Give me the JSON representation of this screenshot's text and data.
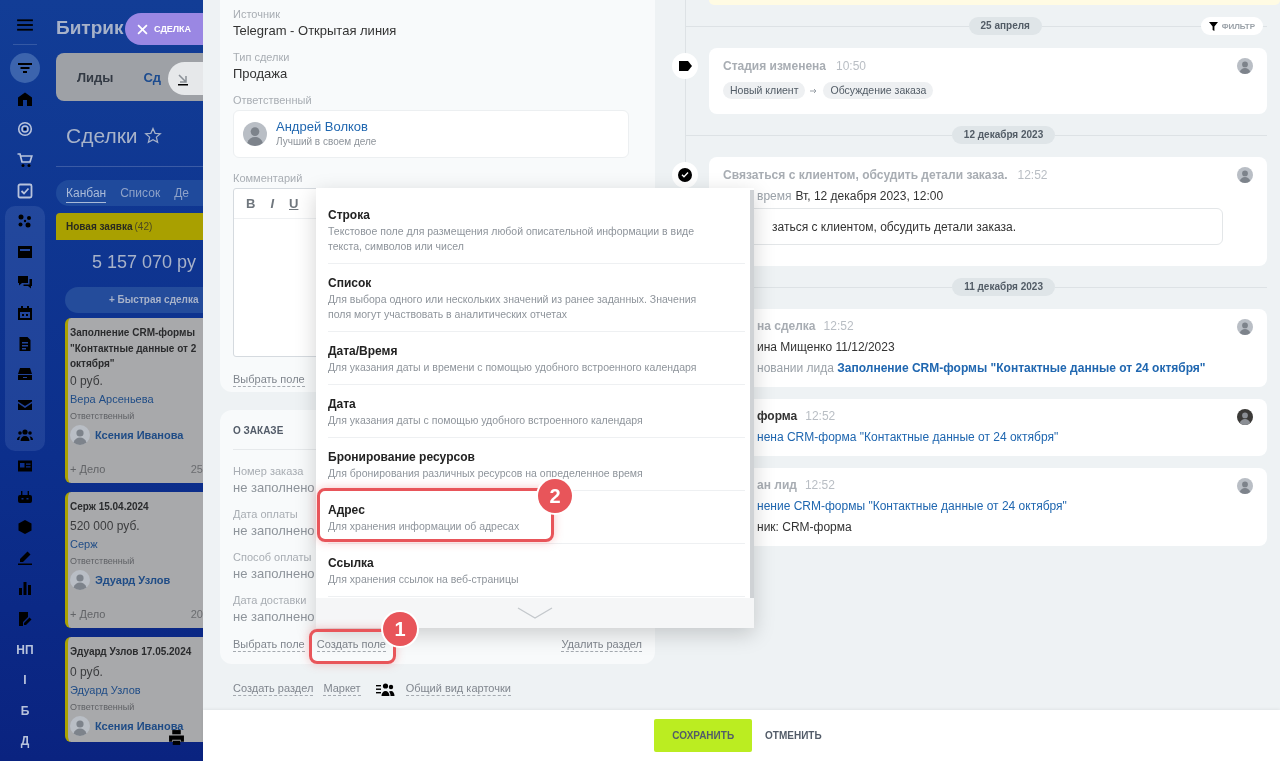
{
  "window": {
    "tab": "СДЕЛКА"
  },
  "sidebar": {
    "labels": [
      "НП",
      "I",
      "Б",
      "Д"
    ]
  },
  "crm": {
    "logo": "Битрик",
    "tabs": [
      {
        "label": "Лиды",
        "selected": false
      },
      {
        "label": "Сд",
        "selected": true
      }
    ],
    "heading": "Сделки",
    "views": [
      {
        "label": "Канбан",
        "selected": true
      },
      {
        "label": "Список",
        "selected": false
      },
      {
        "label": "Де",
        "selected": false
      }
    ],
    "column": {
      "title": "Новая заявка",
      "count": "(42)",
      "total": "5 157 070 ру",
      "quick_add": "+ Быстрая сделка"
    },
    "deals": [
      {
        "title_lines": [
          "Заполнение CRM-формы",
          "\"Контактные данные от 2",
          "октября\""
        ],
        "amount": "0 руб.",
        "client": "Вера Арсеньева",
        "role": "Ответственный",
        "responsible": "Ксения Иванова",
        "add": "+ Дело",
        "date": "25"
      },
      {
        "title_lines": [
          "Серж 15.04.2024"
        ],
        "amount": "520 000 руб.",
        "client": "Серж",
        "role": "Ответственный",
        "responsible": "Эдуард Узлов",
        "add": "+ Дело",
        "date": "20"
      },
      {
        "title_lines": [
          "Эдуард Узлов 17.05.2024"
        ],
        "amount": "0 руб.",
        "client": "Эдуард Узлов",
        "role": "Ответственный",
        "responsible": "Ксения Иванова"
      }
    ]
  },
  "form": {
    "fields": [
      {
        "label": "Источник",
        "value": "Telegram - Открытая линия"
      },
      {
        "label": "Тип сделки",
        "value": "Продажа"
      }
    ],
    "responsible": {
      "label": "Ответственный",
      "name": "Андрей Волков",
      "subtitle": "Лучший в своем деле"
    },
    "comment": {
      "label": "Комментарий",
      "toolbar": [
        "B",
        "I",
        "U"
      ]
    },
    "link": "Выбрать поле"
  },
  "order": {
    "title": "О ЗАКАЗЕ",
    "fields": [
      {
        "label": "Номер заказа",
        "value": "не заполнено",
        "empty": true
      },
      {
        "label": "Дата оплаты",
        "value": "не заполнено",
        "empty": true
      },
      {
        "label": "Способ оплаты",
        "value": "не заполнено",
        "empty": true
      },
      {
        "label": "Дата доставки",
        "value": "не заполнено",
        "empty": true
      }
    ],
    "links": [
      "Выбрать поле",
      "Создать поле",
      "Удалить раздел"
    ]
  },
  "footer_links": [
    {
      "label": "Создать раздел",
      "kind": "link"
    },
    {
      "label": "Маркет",
      "kind": "link"
    },
    {
      "label": "Общий вид карточки",
      "kind": "icon-link"
    }
  ],
  "field_menu": {
    "items": [
      {
        "title": "Строка",
        "description": "Текстовое поле для размещения любой описательной информации в виде текста, символов или чисел"
      },
      {
        "title": "Список",
        "description": "Для выбора одного или нескольких значений из ранее заданных. Значения поля могут участвовать в аналитических отчетах"
      },
      {
        "title": "Дата/Время",
        "description": "Для указания даты и времени с помощью удобного встроенного календаря"
      },
      {
        "title": "Дата",
        "description": "Для указания даты с помощью удобного встроенного календаря"
      },
      {
        "title": "Бронирование ресурсов",
        "description": "Для бронирования различных ресурсов на определенное время"
      },
      {
        "title": "Адрес",
        "description": "Для хранения информации об адресах"
      },
      {
        "title": "Ссылка",
        "description": "Для хранения ссылок на веб-страницы"
      }
    ]
  },
  "callouts": [
    {
      "number": "1"
    },
    {
      "number": "2"
    }
  ],
  "timeline": {
    "filter": "ФИЛЬТР",
    "entries": [
      {
        "kind": "date",
        "label": "25 апреля"
      },
      {
        "kind": "stage",
        "title": "Стадия изменена",
        "time": "10:50",
        "stages": [
          "Новый клиент",
          "Обсуждение заказа"
        ]
      },
      {
        "kind": "date",
        "label": "12 декабря 2023"
      },
      {
        "kind": "activity",
        "title": "Связаться с клиентом, обсудить детали заказа.",
        "time": "12:52",
        "deadline_label": "время",
        "deadline": "Вт, 12 декабря 2023, 12:00",
        "comment": "заться с клиентом, обсудить детали заказа."
      },
      {
        "kind": "date",
        "label": "11 декабря 2023"
      },
      {
        "kind": "event",
        "title": "на сделка",
        "time": "12:52",
        "highlighted": false,
        "lines": [
          {
            "kind": "text",
            "text": "ина Мищенко 11/12/2023"
          },
          {
            "kind": "mixed",
            "text": "новании лида",
            "link": "Заполнение CRM-формы \"Контактные данные от 24 октября\""
          }
        ]
      },
      {
        "kind": "event",
        "title": "форма",
        "time": "12:52",
        "highlighted": true,
        "lines": [
          {
            "kind": "link",
            "text": "нена CRM-форма \"Контактные данные от 24 октября\""
          }
        ]
      },
      {
        "kind": "event",
        "title": "ан лид",
        "time": "12:52",
        "highlighted": false,
        "lines": [
          {
            "kind": "link",
            "text": "нение CRM-формы \"Контактные данные от 24 октября\""
          },
          {
            "kind": "text",
            "text": "ник: CRM-форма"
          }
        ]
      }
    ]
  },
  "buttons": [
    {
      "label": "СОХРАНИТЬ",
      "kind": "primary"
    },
    {
      "label": "ОТМЕНИТЬ",
      "kind": "plain"
    }
  ]
}
